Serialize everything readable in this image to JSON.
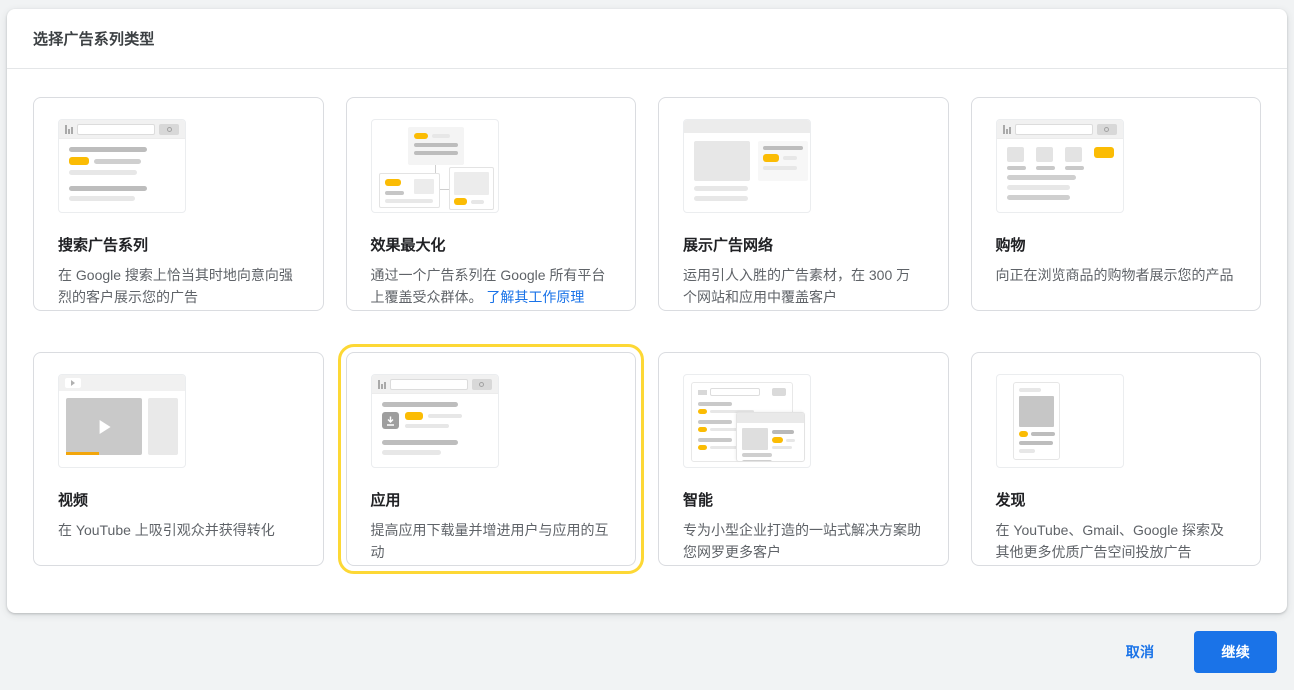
{
  "dialog": {
    "title": "选择广告系列类型"
  },
  "cards": [
    {
      "id": "search",
      "title": "搜索广告系列",
      "description": "在 Google 搜索上恰当其时地向意向强烈的客户展示您的广告",
      "selected": false
    },
    {
      "id": "performance-max",
      "title": "效果最大化",
      "description": "通过一个广告系列在 Google 所有平台上覆盖受众群体。",
      "link_label": "了解其工作原理",
      "selected": false
    },
    {
      "id": "display",
      "title": "展示广告网络",
      "description": "运用引人入胜的广告素材，在 300 万个网站和应用中覆盖客户",
      "selected": false
    },
    {
      "id": "shopping",
      "title": "购物",
      "description": "向正在浏览商品的购物者展示您的产品",
      "selected": false
    },
    {
      "id": "video",
      "title": "视频",
      "description": "在 YouTube 上吸引观众并获得转化",
      "selected": false
    },
    {
      "id": "app",
      "title": "应用",
      "description": "提高应用下载量并增进用户与应用的互动",
      "selected": true
    },
    {
      "id": "smart",
      "title": "智能",
      "description": "专为小型企业打造的一站式解决方案助您网罗更多客户",
      "selected": false
    },
    {
      "id": "discovery",
      "title": "发现",
      "description": "在 YouTube、Gmail、Google 探索及其他更多优质广告空间投放广告",
      "selected": false
    }
  ],
  "footer": {
    "cancel_label": "取消",
    "continue_label": "继续"
  },
  "colors": {
    "accent_blue": "#1a73e8",
    "badge_yellow": "#fbbc04",
    "selection_yellow": "#fdd835",
    "page_background": "#f1f3f4"
  }
}
